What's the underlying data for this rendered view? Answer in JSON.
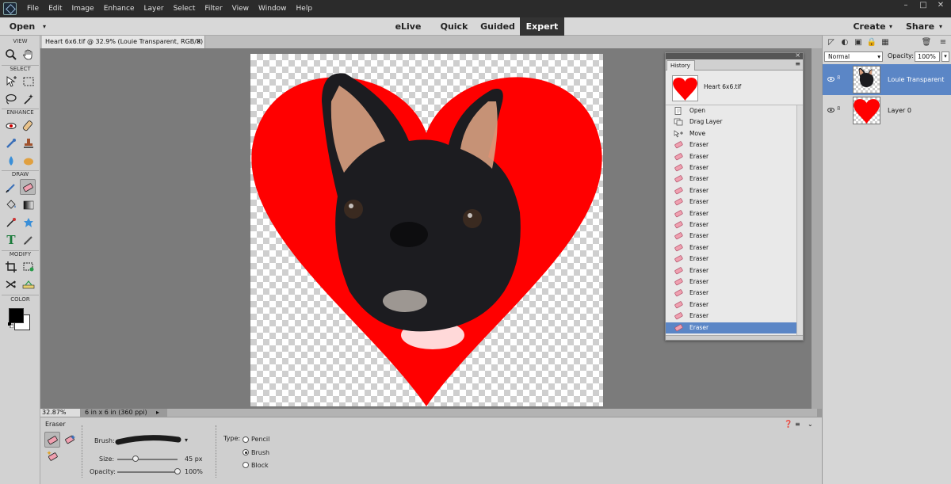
{
  "menubar": {
    "items": [
      "File",
      "Edit",
      "Image",
      "Enhance",
      "Layer",
      "Select",
      "Filter",
      "View",
      "Window",
      "Help"
    ],
    "window_controls": [
      "–",
      "□",
      "✕"
    ]
  },
  "modebar": {
    "open_label": "Open",
    "open_arrow": "▾",
    "modes": [
      "eLive",
      "Quick",
      "Guided",
      "Expert"
    ],
    "active_mode": "Expert",
    "create_label": "Create",
    "share_label": "Share",
    "dropdown_arrow": "▾"
  },
  "toolbox": {
    "sections": [
      "VIEW",
      "SELECT",
      "ENHANCE",
      "DRAW",
      "MODIFY",
      "COLOR"
    ],
    "foreground_color": "#000000",
    "background_color": "#ffffff"
  },
  "document": {
    "tab_title": "Heart 6x6.tif @ 32.9% (Louie Transparent, RGB/8) *",
    "close_glyph": "×",
    "zoom": "32.87%",
    "size_info": "6 in x 6 in (360 ppi)",
    "heart_color": "#ff0000"
  },
  "history": {
    "tab_label": "History",
    "snapshot_label": "Heart 6x6.tif",
    "items": [
      {
        "label": "Open",
        "icon": "open-icon"
      },
      {
        "label": "Drag Layer",
        "icon": "drag-layer-icon"
      },
      {
        "label": "Move",
        "icon": "move-icon"
      },
      {
        "label": "Eraser",
        "icon": "eraser-icon"
      },
      {
        "label": "Eraser",
        "icon": "eraser-icon"
      },
      {
        "label": "Eraser",
        "icon": "eraser-icon"
      },
      {
        "label": "Eraser",
        "icon": "eraser-icon"
      },
      {
        "label": "Eraser",
        "icon": "eraser-icon"
      },
      {
        "label": "Eraser",
        "icon": "eraser-icon"
      },
      {
        "label": "Eraser",
        "icon": "eraser-icon"
      },
      {
        "label": "Eraser",
        "icon": "eraser-icon"
      },
      {
        "label": "Eraser",
        "icon": "eraser-icon"
      },
      {
        "label": "Eraser",
        "icon": "eraser-icon"
      },
      {
        "label": "Eraser",
        "icon": "eraser-icon"
      },
      {
        "label": "Eraser",
        "icon": "eraser-icon"
      },
      {
        "label": "Eraser",
        "icon": "eraser-icon"
      },
      {
        "label": "Eraser",
        "icon": "eraser-icon"
      },
      {
        "label": "Eraser",
        "icon": "eraser-icon"
      },
      {
        "label": "Eraser",
        "icon": "eraser-icon"
      },
      {
        "label": "Eraser",
        "icon": "eraser-icon"
      }
    ],
    "selected_index": 19,
    "selection_color": "#5b86c6"
  },
  "layers": {
    "blend_mode": "Normal",
    "opacity_label": "Opacity:",
    "opacity_value": "100%",
    "items": [
      {
        "name": "Louie Transparent",
        "selected": true
      },
      {
        "name": "Layer 0",
        "selected": false
      }
    ]
  },
  "tool_options": {
    "tool_name": "Eraser",
    "brush_label": "Brush:",
    "size_label": "Size:",
    "size_value": "45 px",
    "size_fraction": 0.3,
    "opacity_label": "Opacity:",
    "opacity_value": "100%",
    "opacity_fraction": 1.0,
    "type_label": "Type:",
    "types": [
      "Pencil",
      "Brush",
      "Block"
    ],
    "selected_type": "Brush"
  }
}
